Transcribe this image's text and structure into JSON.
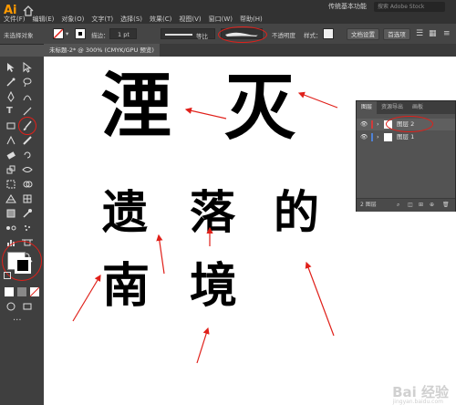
{
  "app": {
    "logo": "Ai",
    "workspace": "传统基本功能",
    "search_placeholder": "搜索 Adobe Stock"
  },
  "menu": [
    "文件(F)",
    "编辑(E)",
    "对象(O)",
    "文字(T)",
    "选择(S)",
    "效果(C)",
    "视图(V)",
    "窗口(W)",
    "帮助(H)"
  ],
  "control_bar": {
    "selection_status": "未选择对象",
    "stroke_label": "描边：",
    "stroke_value": "1 pt",
    "stroke_profile": "等比",
    "opacity_label": "不透明度",
    "style_label": "样式：",
    "doc_setup_button": "文档设置",
    "prefs_button": "首选项"
  },
  "document_tab": "未标题-2* @ 300% (CMYK/GPU 预览)",
  "layers_panel": {
    "tabs": [
      "图层",
      "资源导出",
      "画板"
    ],
    "layers": [
      {
        "name": "图层 2",
        "selected": true,
        "color": "#d13b3b"
      },
      {
        "name": "图层 1",
        "selected": false,
        "color": "#4f82d6"
      }
    ],
    "footer_label": "2 图层"
  },
  "artwork_text": {
    "big_1": "湮",
    "big_2": "灭",
    "row2_1": "遗",
    "row2_2": "落",
    "row2_3": "的",
    "row3_1": "南",
    "row3_2": "境"
  },
  "watermark": {
    "main": "Bai 经验",
    "sub": "jingyan.baidu.com"
  },
  "colors": {
    "annotation": "#e0201a",
    "menubar": "#323232",
    "panel": "#535353"
  }
}
